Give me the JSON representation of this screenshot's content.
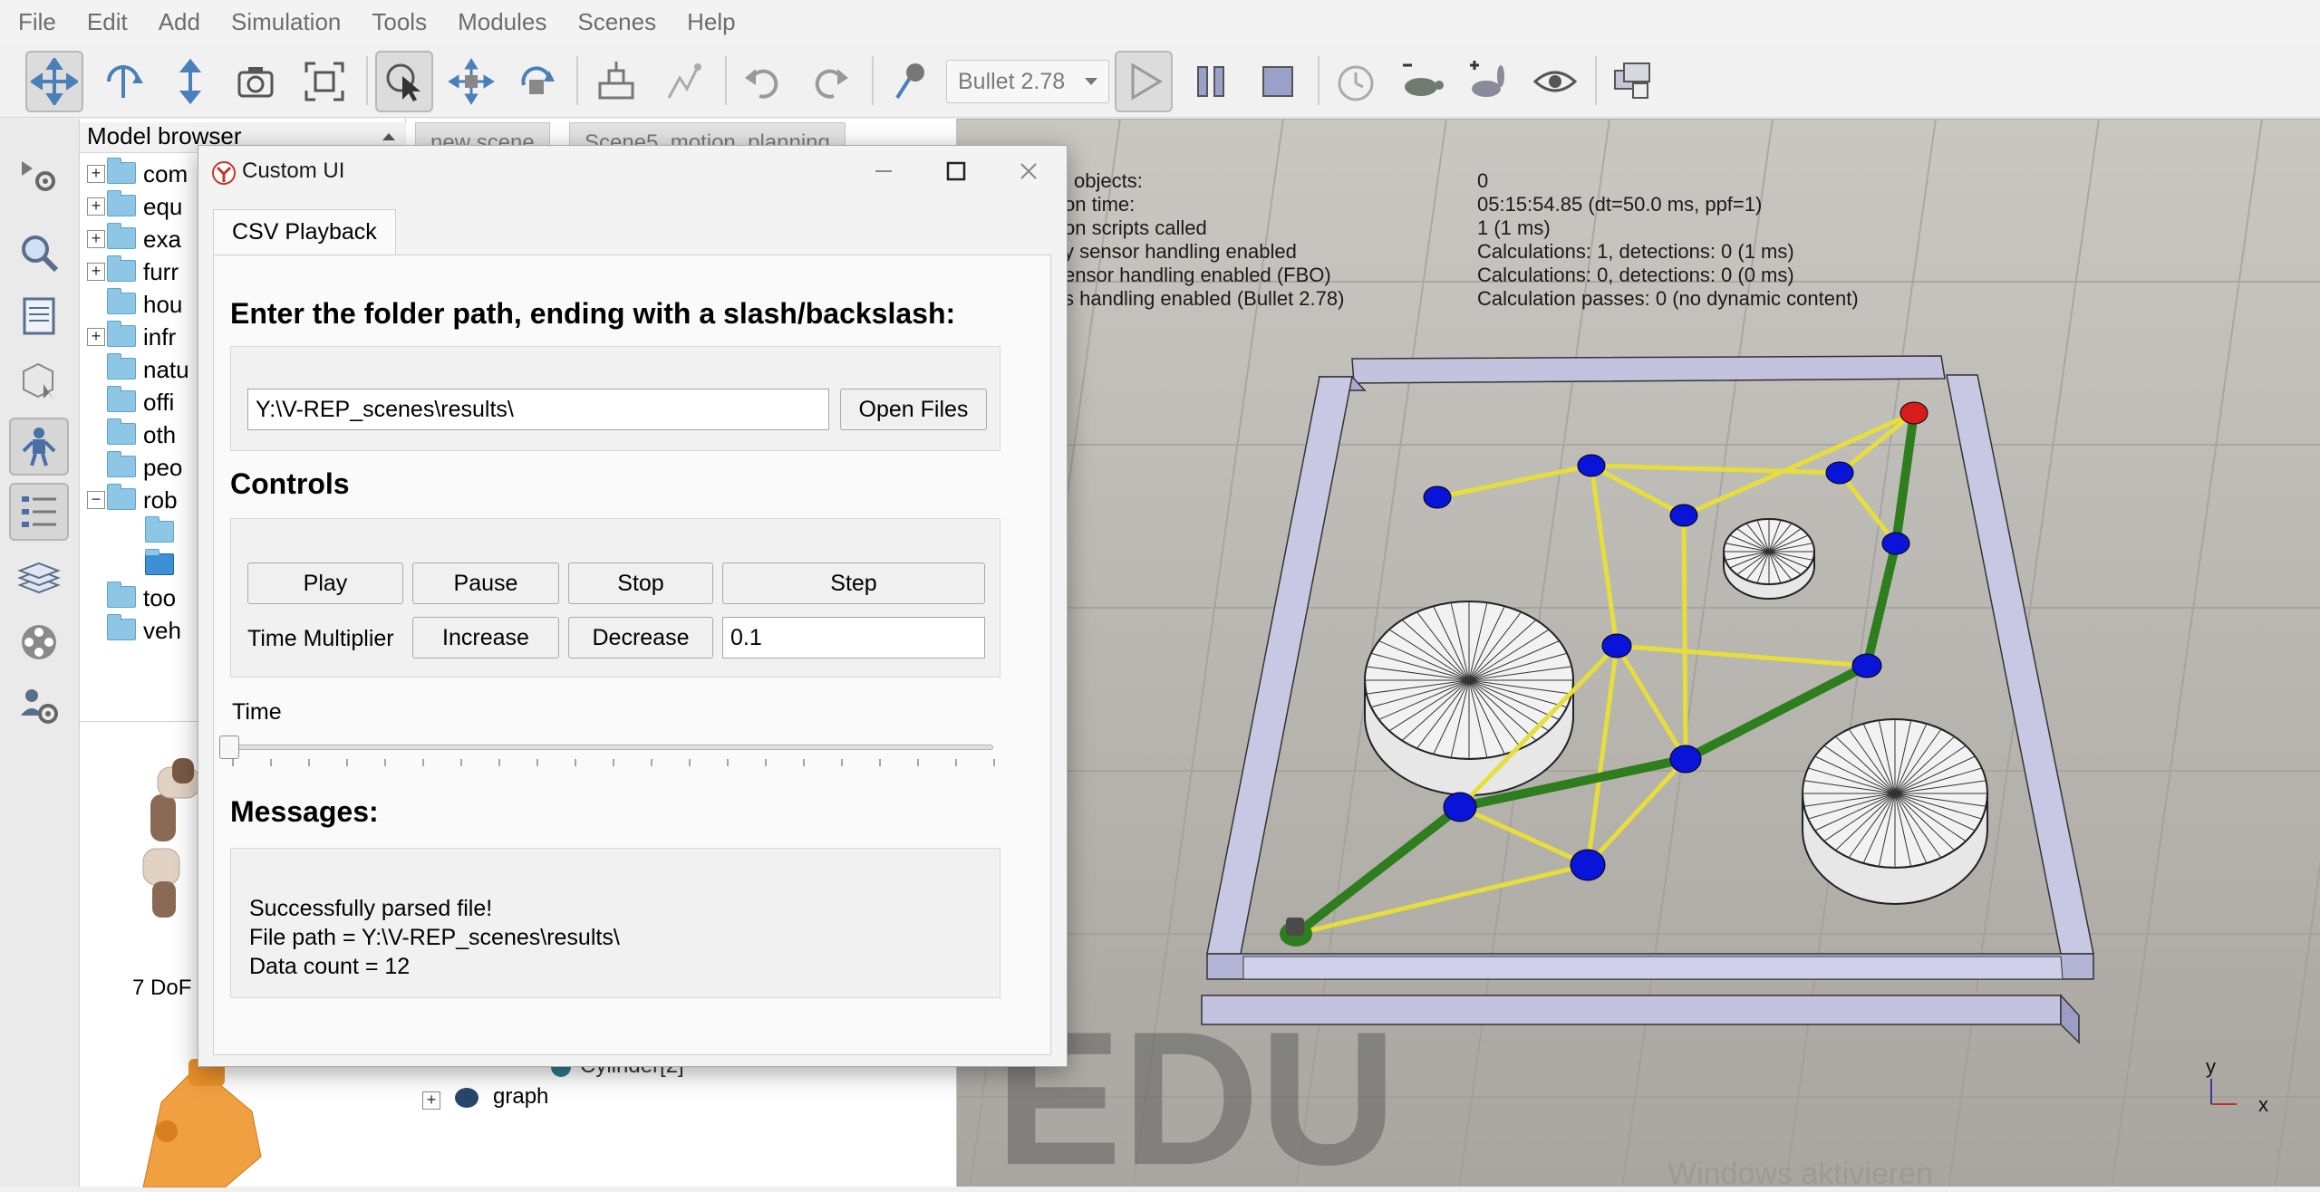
{
  "menu": [
    "File",
    "Edit",
    "Add",
    "Simulation",
    "Tools",
    "Modules",
    "Scenes",
    "Help"
  ],
  "toolbar": {
    "engine": "Bullet 2.78",
    "buttons": [
      "camera-pan-icon",
      "camera-rotate-icon",
      "camera-shift-icon",
      "camera-angle-icon",
      "fit-to-view-icon",
      "click-select-icon",
      "object-shift-icon",
      "object-rotate-icon",
      "assemble-icon",
      "transfer-dna-icon",
      "undo-icon",
      "redo-icon",
      "dynamics-engine-icon",
      "play-icon",
      "pause-icon",
      "stop-icon",
      "realtime-icon",
      "slower-icon",
      "faster-icon",
      "visualization-icon",
      "scene-pages-icon"
    ]
  },
  "left_strip": [
    "simulation-settings-icon",
    "zoom-icon",
    "document-icon",
    "cube-icon",
    "robot-icon",
    "list-icon",
    "layers-icon",
    "film-icon",
    "user-settings-icon"
  ],
  "model_browser": {
    "header": "Model browser",
    "items": [
      {
        "label": "com",
        "expander": "+"
      },
      {
        "label": "equ",
        "expander": "+"
      },
      {
        "label": "exa",
        "expander": "+"
      },
      {
        "label": "furr",
        "expander": "+"
      },
      {
        "label": "hou",
        "expander": ""
      },
      {
        "label": "infr",
        "expander": "+"
      },
      {
        "label": "natu",
        "expander": ""
      },
      {
        "label": "offi",
        "expander": ""
      },
      {
        "label": "oth",
        "expander": ""
      },
      {
        "label": "peo",
        "expander": ""
      },
      {
        "label": "rob",
        "expander": "−"
      },
      {
        "label": "",
        "expander": ""
      },
      {
        "label": "",
        "expander": ""
      },
      {
        "label": "too",
        "expander": ""
      },
      {
        "label": "veh",
        "expander": ""
      }
    ],
    "preview_label": "7 DoF"
  },
  "hierarchy": {
    "tabs": [
      "new scene",
      "Scene5_motion_planning"
    ],
    "rows": [
      {
        "label": "Cylinder[2]",
        "expander": ""
      },
      {
        "label": "graph",
        "expander": "+"
      }
    ]
  },
  "viewport": {
    "info": [
      {
        "key": "l objects:",
        "value": "0"
      },
      {
        "key": "on time:",
        "value": "05:15:54.85 (dt=50.0 ms, ppf=1)"
      },
      {
        "key": "on scripts called",
        "value": "1 (1 ms)"
      },
      {
        "key": "y sensor handling enabled",
        "value": "Calculations: 1, detections: 0 (1 ms)"
      },
      {
        "key": "ensor handling enabled (FBO)",
        "value": "Calculations: 0, detections: 0 (0 ms)"
      },
      {
        "key": "s handling enabled (Bullet 2.78)",
        "value": "Calculation passes: 0 (no dynamic content)"
      }
    ],
    "watermark": "EDU",
    "activation_text": "Windows aktivieren",
    "axis_y": "y",
    "axis_x": "x",
    "colors": {
      "path": "#2e7d1f",
      "edges": "#e6de3c",
      "nodes": "#0a14d8",
      "goal": "#d81c1c",
      "walls": "#c3c3e0"
    }
  },
  "dialog": {
    "title": "Custom UI",
    "tab": "CSV Playback",
    "folder_prompt": "Enter the folder path, ending with a slash/backslash:",
    "folder_path": "Y:\\V-REP_scenes\\results\\",
    "open_files": "Open Files",
    "controls_heading": "Controls",
    "play": "Play",
    "pause": "Pause",
    "stop": "Stop",
    "step": "Step",
    "time_multiplier_label": "Time Multiplier",
    "increase": "Increase",
    "decrease": "Decrease",
    "time_multiplier_value": "0.1",
    "time_label": "Time",
    "time_slider_value": 0,
    "messages_heading": "Messages:",
    "messages": [
      "Successfully parsed file!",
      "File path = Y:\\V-REP_scenes\\results\\",
      "Data count = 12"
    ]
  }
}
